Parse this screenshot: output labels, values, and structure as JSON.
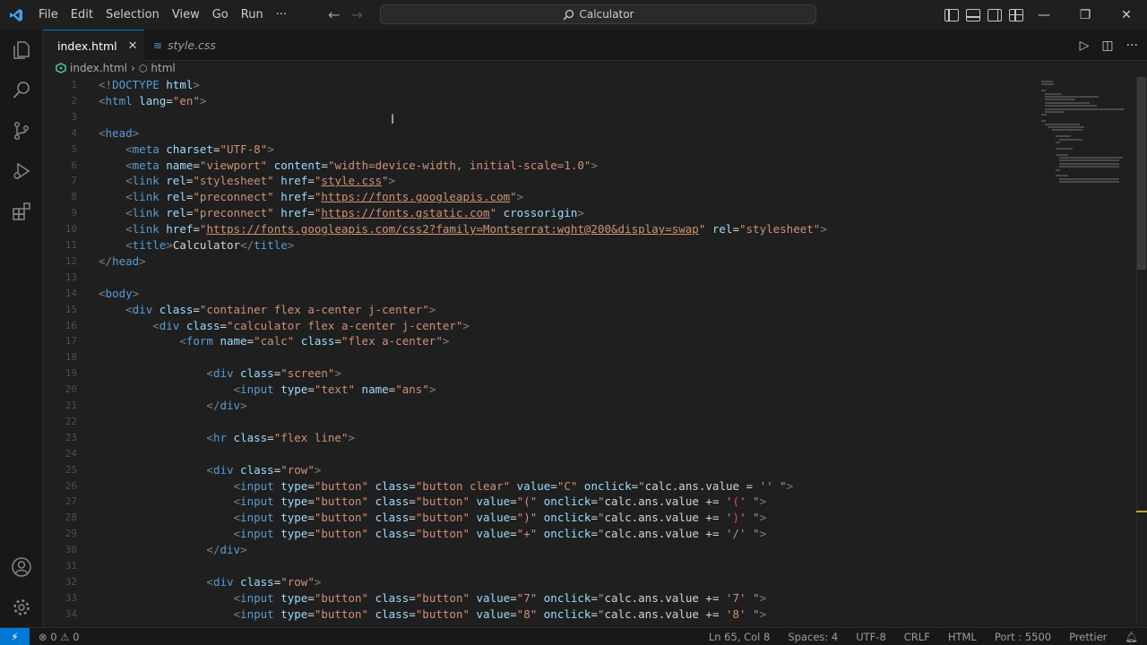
{
  "menu": [
    "File",
    "Edit",
    "Selection",
    "View",
    "Go",
    "Run",
    "···"
  ],
  "command_center": {
    "label": "Calculator"
  },
  "window_controls": {
    "minimize": "—",
    "restore": "❐",
    "close": "✕"
  },
  "tabs": [
    {
      "label": "index.html",
      "close": "✕",
      "active": true
    },
    {
      "label": "style.css",
      "active": false
    }
  ],
  "editor_actions": {
    "run": "▷",
    "split": "◫",
    "more": "···"
  },
  "breadcrumb": {
    "file": "index.html",
    "separator": "›",
    "symbol": "html"
  },
  "code_lines": [
    {
      "n": "1",
      "tokens": [
        [
          "br",
          "<!"
        ],
        [
          "tag",
          "DOCTYPE"
        ],
        [
          "attr",
          " html"
        ],
        [
          "br",
          ">"
        ]
      ]
    },
    {
      "n": "2",
      "tokens": [
        [
          "br",
          "<"
        ],
        [
          "tag",
          "html"
        ],
        [
          "attr",
          " lang"
        ],
        [
          "txt",
          "="
        ],
        [
          "str",
          "\"en\""
        ],
        [
          "br",
          ">"
        ]
      ]
    },
    {
      "n": "3",
      "tokens": []
    },
    {
      "n": "4",
      "tokens": [
        [
          "br",
          "<"
        ],
        [
          "tag",
          "head"
        ],
        [
          "br",
          ">"
        ]
      ]
    },
    {
      "n": "5",
      "tokens": [
        [
          "txt",
          "    "
        ],
        [
          "br",
          "<"
        ],
        [
          "tag",
          "meta"
        ],
        [
          "attr",
          " charset"
        ],
        [
          "txt",
          "="
        ],
        [
          "str",
          "\"UTF-8\""
        ],
        [
          "br",
          ">"
        ]
      ]
    },
    {
      "n": "6",
      "tokens": [
        [
          "txt",
          "    "
        ],
        [
          "br",
          "<"
        ],
        [
          "tag",
          "meta"
        ],
        [
          "attr",
          " name"
        ],
        [
          "txt",
          "="
        ],
        [
          "str",
          "\"viewport\""
        ],
        [
          "attr",
          " content"
        ],
        [
          "txt",
          "="
        ],
        [
          "str",
          "\"width=device-width, initial-scale=1.0\""
        ],
        [
          "br",
          ">"
        ]
      ]
    },
    {
      "n": "7",
      "tokens": [
        [
          "txt",
          "    "
        ],
        [
          "br",
          "<"
        ],
        [
          "tag",
          "link"
        ],
        [
          "attr",
          " rel"
        ],
        [
          "txt",
          "="
        ],
        [
          "str",
          "\"stylesheet\""
        ],
        [
          "attr",
          " href"
        ],
        [
          "txt",
          "="
        ],
        [
          "str",
          "\""
        ],
        [
          "link",
          "style.css"
        ],
        [
          "str",
          "\""
        ],
        [
          "br",
          ">"
        ]
      ]
    },
    {
      "n": "8",
      "tokens": [
        [
          "txt",
          "    "
        ],
        [
          "br",
          "<"
        ],
        [
          "tag",
          "link"
        ],
        [
          "attr",
          " rel"
        ],
        [
          "txt",
          "="
        ],
        [
          "str",
          "\"preconnect\""
        ],
        [
          "attr",
          " href"
        ],
        [
          "txt",
          "="
        ],
        [
          "str",
          "\""
        ],
        [
          "link",
          "https://fonts.googleapis.com"
        ],
        [
          "str",
          "\""
        ],
        [
          "br",
          ">"
        ]
      ]
    },
    {
      "n": "9",
      "tokens": [
        [
          "txt",
          "    "
        ],
        [
          "br",
          "<"
        ],
        [
          "tag",
          "link"
        ],
        [
          "attr",
          " rel"
        ],
        [
          "txt",
          "="
        ],
        [
          "str",
          "\"preconnect\""
        ],
        [
          "attr",
          " href"
        ],
        [
          "txt",
          "="
        ],
        [
          "str",
          "\""
        ],
        [
          "link",
          "https://fonts.gstatic.com"
        ],
        [
          "str",
          "\""
        ],
        [
          "attr",
          " crossorigin"
        ],
        [
          "br",
          ">"
        ]
      ]
    },
    {
      "n": "10",
      "tokens": [
        [
          "txt",
          "    "
        ],
        [
          "br",
          "<"
        ],
        [
          "tag",
          "link"
        ],
        [
          "attr",
          " href"
        ],
        [
          "txt",
          "="
        ],
        [
          "str",
          "\""
        ],
        [
          "link",
          "https://fonts.googleapis.com/css2?family=Montserrat:wght@200&display=swap"
        ],
        [
          "str",
          "\""
        ],
        [
          "attr",
          " rel"
        ],
        [
          "txt",
          "="
        ],
        [
          "str",
          "\"stylesheet\""
        ],
        [
          "br",
          ">"
        ]
      ]
    },
    {
      "n": "11",
      "tokens": [
        [
          "txt",
          "    "
        ],
        [
          "br",
          "<"
        ],
        [
          "tag",
          "title"
        ],
        [
          "br",
          ">"
        ],
        [
          "txt",
          "Calculator"
        ],
        [
          "br",
          "</"
        ],
        [
          "tag",
          "title"
        ],
        [
          "br",
          ">"
        ]
      ]
    },
    {
      "n": "12",
      "tokens": [
        [
          "br",
          "</"
        ],
        [
          "tag",
          "head"
        ],
        [
          "br",
          ">"
        ]
      ]
    },
    {
      "n": "13",
      "tokens": []
    },
    {
      "n": "14",
      "tokens": [
        [
          "br",
          "<"
        ],
        [
          "tag",
          "body"
        ],
        [
          "br",
          ">"
        ]
      ]
    },
    {
      "n": "15",
      "tokens": [
        [
          "txt",
          "    "
        ],
        [
          "br",
          "<"
        ],
        [
          "tag",
          "div"
        ],
        [
          "attr",
          " class"
        ],
        [
          "txt",
          "="
        ],
        [
          "str",
          "\"container flex a-center j-center\""
        ],
        [
          "br",
          ">"
        ]
      ]
    },
    {
      "n": "16",
      "tokens": [
        [
          "txt",
          "        "
        ],
        [
          "br",
          "<"
        ],
        [
          "tag",
          "div"
        ],
        [
          "attr",
          " class"
        ],
        [
          "txt",
          "="
        ],
        [
          "str",
          "\"calculator flex a-center j-center\""
        ],
        [
          "br",
          ">"
        ]
      ]
    },
    {
      "n": "17",
      "tokens": [
        [
          "txt",
          "            "
        ],
        [
          "br",
          "<"
        ],
        [
          "tag",
          "form"
        ],
        [
          "attr",
          " name"
        ],
        [
          "txt",
          "="
        ],
        [
          "str",
          "\"calc\""
        ],
        [
          "attr",
          " class"
        ],
        [
          "txt",
          "="
        ],
        [
          "str",
          "\"flex a-center\""
        ],
        [
          "br",
          ">"
        ]
      ]
    },
    {
      "n": "18",
      "tokens": []
    },
    {
      "n": "19",
      "tokens": [
        [
          "txt",
          "                "
        ],
        [
          "br",
          "<"
        ],
        [
          "tag",
          "div"
        ],
        [
          "attr",
          " class"
        ],
        [
          "txt",
          "="
        ],
        [
          "str",
          "\"screen\""
        ],
        [
          "br",
          ">"
        ]
      ]
    },
    {
      "n": "20",
      "tokens": [
        [
          "txt",
          "                    "
        ],
        [
          "br",
          "<"
        ],
        [
          "tag",
          "input"
        ],
        [
          "attr",
          " type"
        ],
        [
          "txt",
          "="
        ],
        [
          "str",
          "\"text\""
        ],
        [
          "attr",
          " name"
        ],
        [
          "txt",
          "="
        ],
        [
          "str",
          "\"ans\""
        ],
        [
          "br",
          ">"
        ]
      ]
    },
    {
      "n": "21",
      "tokens": [
        [
          "txt",
          "                "
        ],
        [
          "br",
          "</"
        ],
        [
          "tag",
          "div"
        ],
        [
          "br",
          ">"
        ]
      ]
    },
    {
      "n": "22",
      "tokens": []
    },
    {
      "n": "23",
      "tokens": [
        [
          "txt",
          "                "
        ],
        [
          "br",
          "<"
        ],
        [
          "tag",
          "hr"
        ],
        [
          "attr",
          " class"
        ],
        [
          "txt",
          "="
        ],
        [
          "str",
          "\"flex line\""
        ],
        [
          "br",
          ">"
        ]
      ]
    },
    {
      "n": "24",
      "tokens": []
    },
    {
      "n": "25",
      "tokens": [
        [
          "txt",
          "                "
        ],
        [
          "br",
          "<"
        ],
        [
          "tag",
          "div"
        ],
        [
          "attr",
          " class"
        ],
        [
          "txt",
          "="
        ],
        [
          "str",
          "\"row\""
        ],
        [
          "br",
          ">"
        ]
      ]
    },
    {
      "n": "26",
      "tokens": [
        [
          "txt",
          "                    "
        ],
        [
          "br",
          "<"
        ],
        [
          "tag",
          "input"
        ],
        [
          "attr",
          " type"
        ],
        [
          "txt",
          "="
        ],
        [
          "str",
          "\"button\""
        ],
        [
          "attr",
          " class"
        ],
        [
          "txt",
          "="
        ],
        [
          "str",
          "\"button clear\""
        ],
        [
          "attr",
          " value"
        ],
        [
          "txt",
          "="
        ],
        [
          "str",
          "\"C\""
        ],
        [
          "attr",
          " onclick"
        ],
        [
          "txt",
          "="
        ],
        [
          "str",
          "\""
        ],
        [
          "txt",
          "calc.ans.value = "
        ],
        [
          "str",
          "'' \""
        ],
        [
          "br",
          ">"
        ]
      ]
    },
    {
      "n": "27",
      "tokens": [
        [
          "txt",
          "                    "
        ],
        [
          "br",
          "<"
        ],
        [
          "tag",
          "input"
        ],
        [
          "attr",
          " type"
        ],
        [
          "txt",
          "="
        ],
        [
          "str",
          "\"button\""
        ],
        [
          "attr",
          " class"
        ],
        [
          "txt",
          "="
        ],
        [
          "str",
          "\"button\""
        ],
        [
          "attr",
          " value"
        ],
        [
          "txt",
          "="
        ],
        [
          "str",
          "\"(\""
        ],
        [
          "attr",
          " onclick"
        ],
        [
          "txt",
          "="
        ],
        [
          "str",
          "\""
        ],
        [
          "txt",
          "calc.ans.value += "
        ],
        [
          "str",
          "'"
        ],
        [
          "red",
          "("
        ],
        [
          "str",
          "' \""
        ],
        [
          "br",
          ">"
        ]
      ]
    },
    {
      "n": "28",
      "tokens": [
        [
          "txt",
          "                    "
        ],
        [
          "br",
          "<"
        ],
        [
          "tag",
          "input"
        ],
        [
          "attr",
          " type"
        ],
        [
          "txt",
          "="
        ],
        [
          "str",
          "\"button\""
        ],
        [
          "attr",
          " class"
        ],
        [
          "txt",
          "="
        ],
        [
          "str",
          "\"button\""
        ],
        [
          "attr",
          " value"
        ],
        [
          "txt",
          "="
        ],
        [
          "str",
          "\")\""
        ],
        [
          "attr",
          " onclick"
        ],
        [
          "txt",
          "="
        ],
        [
          "str",
          "\""
        ],
        [
          "txt",
          "calc.ans.value += "
        ],
        [
          "str",
          "'"
        ],
        [
          "red",
          ")"
        ],
        [
          "str",
          "' \""
        ],
        [
          "br",
          ">"
        ]
      ]
    },
    {
      "n": "29",
      "tokens": [
        [
          "txt",
          "                    "
        ],
        [
          "br",
          "<"
        ],
        [
          "tag",
          "input"
        ],
        [
          "attr",
          " type"
        ],
        [
          "txt",
          "="
        ],
        [
          "str",
          "\"button\""
        ],
        [
          "attr",
          " class"
        ],
        [
          "txt",
          "="
        ],
        [
          "str",
          "\"button\""
        ],
        [
          "attr",
          " value"
        ],
        [
          "txt",
          "="
        ],
        [
          "str",
          "\"+\""
        ],
        [
          "attr",
          " onclick"
        ],
        [
          "txt",
          "="
        ],
        [
          "str",
          "\""
        ],
        [
          "txt",
          "calc.ans.value += "
        ],
        [
          "str",
          "'/' \""
        ],
        [
          "br",
          ">"
        ]
      ]
    },
    {
      "n": "30",
      "tokens": [
        [
          "txt",
          "                "
        ],
        [
          "br",
          "</"
        ],
        [
          "tag",
          "div"
        ],
        [
          "br",
          ">"
        ]
      ]
    },
    {
      "n": "31",
      "tokens": []
    },
    {
      "n": "32",
      "tokens": [
        [
          "txt",
          "                "
        ],
        [
          "br",
          "<"
        ],
        [
          "tag",
          "div"
        ],
        [
          "attr",
          " class"
        ],
        [
          "txt",
          "="
        ],
        [
          "str",
          "\"row\""
        ],
        [
          "br",
          ">"
        ]
      ]
    },
    {
      "n": "33",
      "tokens": [
        [
          "txt",
          "                    "
        ],
        [
          "br",
          "<"
        ],
        [
          "tag",
          "input"
        ],
        [
          "attr",
          " type"
        ],
        [
          "txt",
          "="
        ],
        [
          "str",
          "\"button\""
        ],
        [
          "attr",
          " class"
        ],
        [
          "txt",
          "="
        ],
        [
          "str",
          "\"button\""
        ],
        [
          "attr",
          " value"
        ],
        [
          "txt",
          "="
        ],
        [
          "str",
          "\"7\""
        ],
        [
          "attr",
          " onclick"
        ],
        [
          "txt",
          "="
        ],
        [
          "str",
          "\""
        ],
        [
          "txt",
          "calc.ans.value += "
        ],
        [
          "str",
          "'7' \""
        ],
        [
          "br",
          ">"
        ]
      ]
    },
    {
      "n": "34",
      "tokens": [
        [
          "txt",
          "                    "
        ],
        [
          "br",
          "<"
        ],
        [
          "tag",
          "input"
        ],
        [
          "attr",
          " type"
        ],
        [
          "txt",
          "="
        ],
        [
          "str",
          "\"button\""
        ],
        [
          "attr",
          " class"
        ],
        [
          "txt",
          "="
        ],
        [
          "str",
          "\"button\""
        ],
        [
          "attr",
          " value"
        ],
        [
          "txt",
          "="
        ],
        [
          "str",
          "\"8\""
        ],
        [
          "attr",
          " onclick"
        ],
        [
          "txt",
          "="
        ],
        [
          "str",
          "\""
        ],
        [
          "txt",
          "calc.ans.value += "
        ],
        [
          "str",
          "'8' \""
        ],
        [
          "br",
          ">"
        ]
      ]
    }
  ],
  "status": {
    "remote": "⚡",
    "problems": "⊗ 0 ⚠ 0",
    "position": "Ln 65, Col 8",
    "indent": "Spaces: 4",
    "encoding": "UTF-8",
    "eol": "CRLF",
    "language": "HTML",
    "port": "Port : 5500",
    "formatter": "Prettier"
  },
  "colors": {
    "accent": "#0078d4",
    "tag": "#569cd6",
    "attr": "#9cdcfe",
    "string": "#ce9178"
  }
}
